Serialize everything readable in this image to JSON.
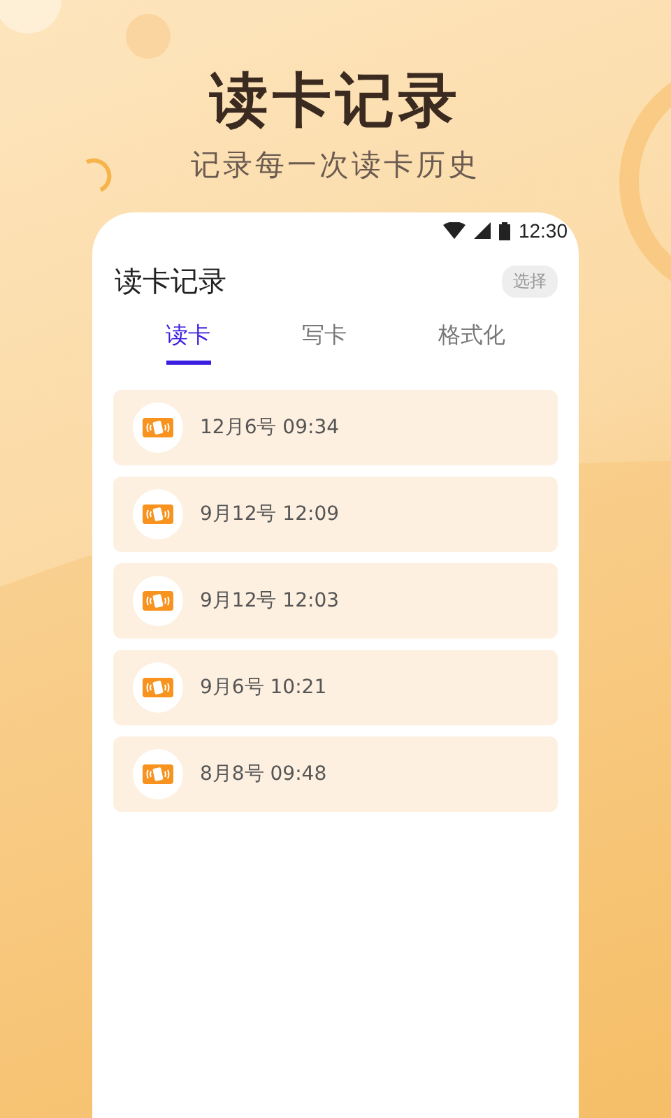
{
  "header": {
    "title": "读卡记录",
    "subtitle": "记录每一次读卡历史"
  },
  "status_bar": {
    "time": "12:30"
  },
  "screen": {
    "title": "读卡记录",
    "action": "选择"
  },
  "tabs": [
    {
      "label": "读卡",
      "selected": true
    },
    {
      "label": "写卡",
      "selected": false
    },
    {
      "label": "格式化",
      "selected": false
    }
  ],
  "records": [
    {
      "time": "12月6号 09:34"
    },
    {
      "time": "9月12号 12:09"
    },
    {
      "time": "9月12号 12:03"
    },
    {
      "time": "9月6号 10:21"
    },
    {
      "time": "8月8号 09:48"
    }
  ]
}
